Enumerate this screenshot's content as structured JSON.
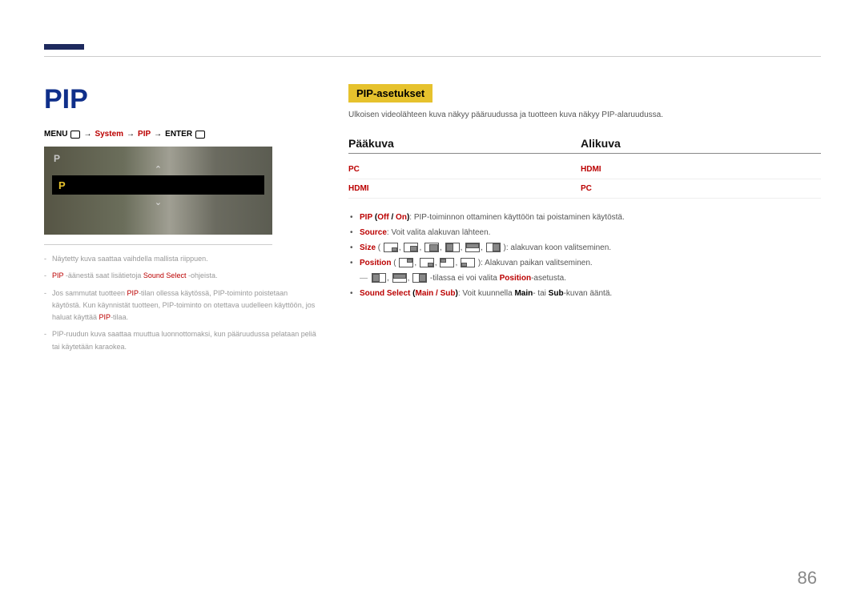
{
  "left": {
    "title": "PIP",
    "breadcrumb": {
      "menu": "MENU",
      "system": "System",
      "pip": "PIP",
      "enter": "ENTER"
    },
    "preview": {
      "top_label": "P",
      "highlight_label": "P"
    },
    "notes": {
      "n1": "Näytetty kuva saattaa vaihdella mallista riippuen.",
      "n2_pre": "PIP",
      "n2_mid": " -äänestä saat lisätietoja ",
      "n2_bold": "Sound Select",
      "n2_post": " -ohjeista.",
      "n3a": "Jos sammutat tuotteen ",
      "n3b": "PIP",
      "n3c": "-tilan ollessa käytössä, PIP-toiminto poistetaan käytöstä. Kun käynnistät tuotteen, PIP-toiminto on otettava uudelleen käyttöön, jos haluat käyttää ",
      "n3d": "PIP",
      "n3e": "-tilaa.",
      "n4": "PIP-ruudun kuva saattaa muuttua luonnottomaksi, kun pääruudussa pelataan peliä tai käytetään karaokea."
    }
  },
  "right": {
    "section_label": "PIP-asetukset",
    "desc": "Ulkoisen videolähteen kuva näkyy pääruudussa ja tuotteen kuva näkyy PIP-alaruudussa.",
    "headings": {
      "main": "Pääkuva",
      "sub": "Alikuva"
    },
    "table": {
      "r1a": "PC",
      "r1b": "HDMI",
      "r2a": "HDMI",
      "r2b": "PC"
    },
    "bullets": {
      "b1_label": "PIP",
      "b1_off": "Off",
      "b1_on": "On",
      "b1_text": ": PIP-toiminnon ottaminen käyttöön tai poistaminen käytöstä.",
      "b2_label": "Source",
      "b2_text": ": Voit valita alakuvan lähteen.",
      "b3_label": "Size",
      "b3_text": ": alakuvan koon valitseminen.",
      "b4_label": "Position",
      "b4_text": ": Alakuvan paikan valitseminen.",
      "b4_sub_text": " -tilassa ei voi valita ",
      "b4_sub_pos": "Position",
      "b4_sub_end": "-asetusta.",
      "b5_label": "Sound Select",
      "b5_paren": "Main / Sub",
      "b5_text": ": Voit kuunnella ",
      "b5_main": "Main",
      "b5_or": "- tai ",
      "b5_sub": "Sub",
      "b5_end": "-kuvan ääntä."
    }
  },
  "page_number": "86"
}
